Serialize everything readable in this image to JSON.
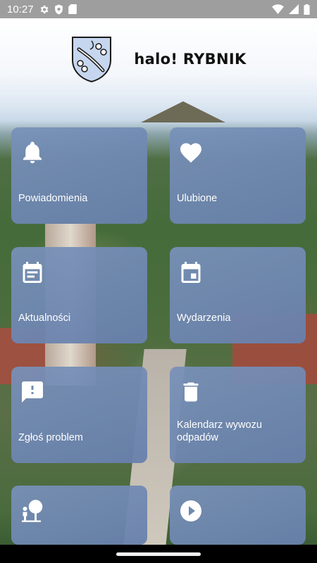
{
  "status_bar": {
    "time": "10:27",
    "icons": [
      "settings-icon",
      "shield-icon",
      "sd-card-icon",
      "wifi-icon",
      "signal-icon",
      "battery-icon"
    ]
  },
  "header": {
    "title": "halo! RYBNIK",
    "logo": "rybnik-coat-of-arms"
  },
  "tiles": [
    {
      "label": "Powiadomienia",
      "icon": "bell-icon"
    },
    {
      "label": "Ulubione",
      "icon": "heart-icon"
    },
    {
      "label": "Aktualności",
      "icon": "news-calendar-icon"
    },
    {
      "label": "Wydarzenia",
      "icon": "event-calendar-icon"
    },
    {
      "label": "Zgłoś problem",
      "icon": "report-problem-icon"
    },
    {
      "label": "Kalendarz wywozu odpadów",
      "icon": "trash-icon"
    },
    {
      "label": "",
      "icon": "tree-person-icon"
    },
    {
      "label": "",
      "icon": "play-icon"
    }
  ],
  "colors": {
    "tile": "#7488b0",
    "status_bar": "#9e9e9e",
    "nav_bar": "#000000",
    "title_text": "#111111"
  }
}
